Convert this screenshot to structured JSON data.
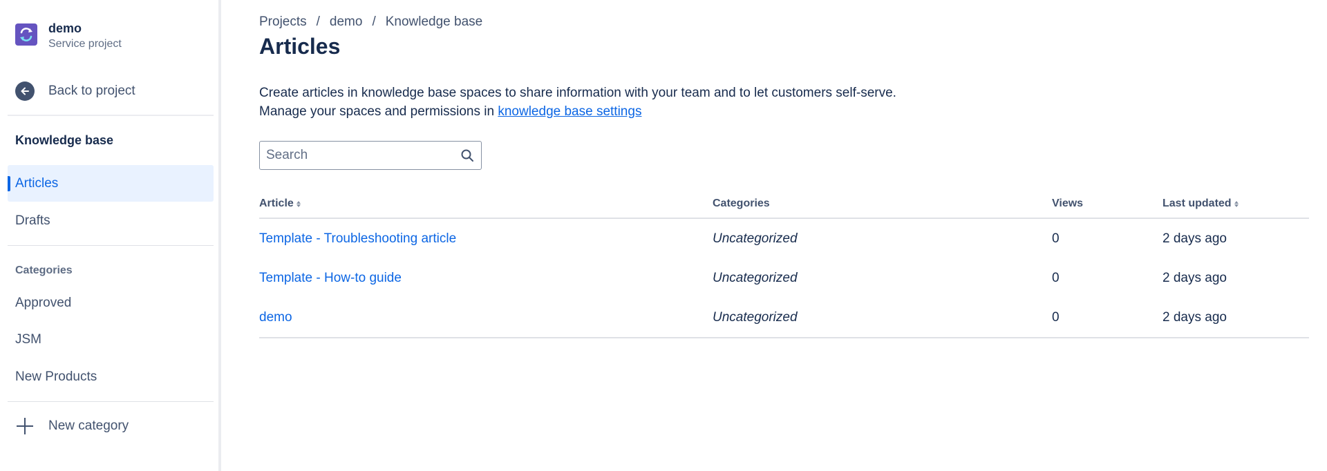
{
  "project": {
    "name": "demo",
    "type": "Service project"
  },
  "sidebar": {
    "back_label": "Back to project",
    "section_title": "Knowledge base",
    "nav": [
      {
        "label": "Articles",
        "active": true
      },
      {
        "label": "Drafts",
        "active": false
      }
    ],
    "categories_title": "Categories",
    "categories": [
      {
        "label": "Approved"
      },
      {
        "label": "JSM"
      },
      {
        "label": "New Products"
      }
    ],
    "new_category_label": "New category"
  },
  "breadcrumb": {
    "items": [
      "Projects",
      "demo",
      "Knowledge base"
    ],
    "separator": "/"
  },
  "page": {
    "title": "Articles",
    "description_line1": "Create articles in knowledge base spaces to share information with your team and to let customers self-serve.",
    "description_line2_prefix": "Manage your spaces and permissions in ",
    "description_link": "knowledge base settings"
  },
  "search": {
    "placeholder": "Search",
    "value": ""
  },
  "table": {
    "columns": {
      "article": "Article",
      "categories": "Categories",
      "views": "Views",
      "updated": "Last updated"
    },
    "rows": [
      {
        "article": "Template - Troubleshooting article",
        "category": "Uncategorized",
        "views": "0",
        "updated": "2 days ago"
      },
      {
        "article": "Template - How-to guide",
        "category": "Uncategorized",
        "views": "0",
        "updated": "2 days ago"
      },
      {
        "article": "demo",
        "category": "Uncategorized",
        "views": "0",
        "updated": "2 days ago"
      }
    ]
  },
  "colors": {
    "accent": "#0c66e4",
    "active_bg": "#e9f2ff",
    "text": "#172b4d",
    "subtle_text": "#42526e",
    "avatar_bg": "#6554c0"
  },
  "icons": [
    "project-avatar-icon",
    "back-arrow-icon",
    "search-icon",
    "sort-icon",
    "plus-icon"
  ]
}
